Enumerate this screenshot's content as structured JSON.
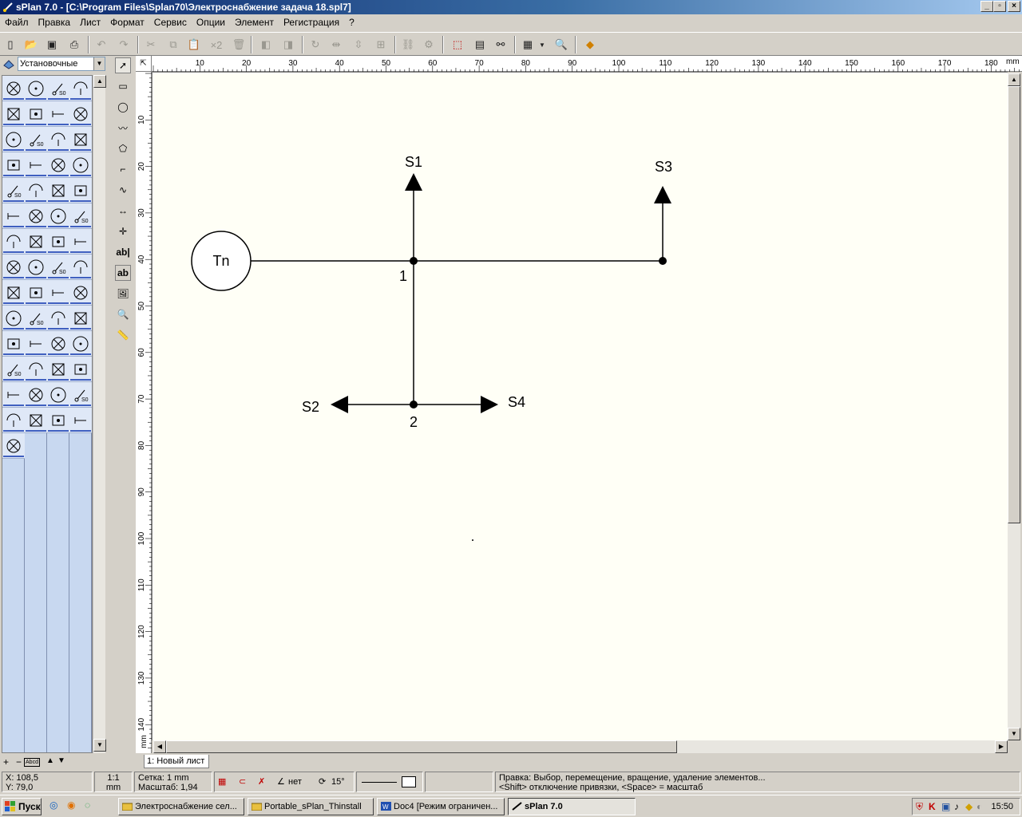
{
  "window": {
    "title": "sPlan 7.0 - [C:\\Program Files\\Splan70\\Электроснабжение задача 18.spl7]",
    "min_label": "_",
    "restore_label": "▫",
    "close_label": "×",
    "doc_min": "_",
    "doc_restore": "▫",
    "doc_close": "×"
  },
  "menu": [
    "Файл",
    "Правка",
    "Лист",
    "Формат",
    "Сервис",
    "Опции",
    "Элемент",
    "Регистрация",
    "?"
  ],
  "toolbar": {
    "copy_count": "×2"
  },
  "library": {
    "selected": "Установочные"
  },
  "ruler": {
    "h": [
      "10",
      "20",
      "30",
      "40",
      "50",
      "60",
      "70",
      "80",
      "90",
      "100",
      "110",
      "120",
      "130",
      "140",
      "150",
      "160",
      "170",
      "180"
    ],
    "h_unit": "mm",
    "v": [
      "10",
      "20",
      "30",
      "40",
      "50",
      "60",
      "70",
      "80",
      "90",
      "100",
      "110",
      "120",
      "130",
      "140"
    ],
    "v_unit": "mm"
  },
  "diagram": {
    "source_label": "Tn",
    "s1": "S1",
    "s2": "S2",
    "s3": "S3",
    "s4": "S4",
    "node1": "1",
    "node2": "2"
  },
  "sheet_tab": "1: Новый лист",
  "statusbar": {
    "x": "X: 108,5",
    "y": "Y: 79,0",
    "scale_ratio": "1:1",
    "scale_unit": "mm",
    "grid": "Сетка: 1 mm",
    "zoom": "Масштаб:  1,94",
    "angle_label": "нет",
    "rotate_label": "15°",
    "hint1": "Правка: Выбор, перемещение, вращение, удаление элементов...",
    "hint2": "<Shift> отключение привязки, <Space> = масштаб"
  },
  "taskbar": {
    "start": "Пуск",
    "tasks": [
      "Электроснабжение сел...",
      "Portable_sPlan_Thinstall",
      "Doc4 [Режим ограничен...",
      "sPlan 7.0"
    ],
    "clock": "15:50"
  }
}
